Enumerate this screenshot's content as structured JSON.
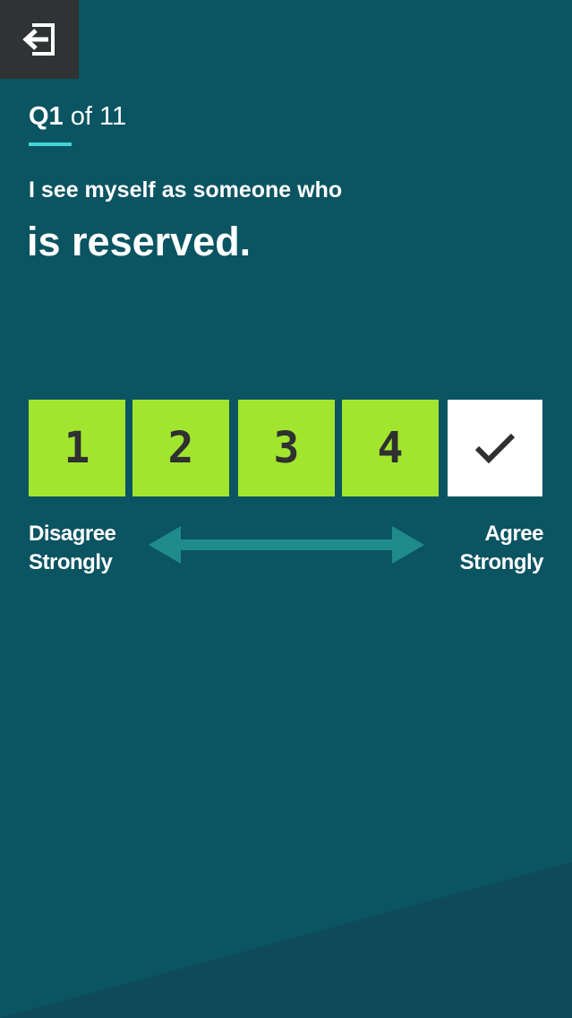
{
  "header": {
    "exit_icon": "exit-arrow-icon"
  },
  "progress": {
    "current": "Q1",
    "of_text": "of 11",
    "underline_color": "#3fd6d4"
  },
  "question": {
    "lead": "I see myself as someone who",
    "statement": "is reserved."
  },
  "scale": {
    "options": [
      "1",
      "2",
      "3",
      "4"
    ],
    "selected_icon": "checkmark-icon",
    "left_label": [
      "Disagree",
      "Strongly"
    ],
    "right_label": [
      "Agree",
      "Strongly"
    ],
    "arrow_icon": "double-arrow-icon"
  },
  "colors": {
    "background": "#0b5462",
    "option": "#a1e52e",
    "selected_option": "#ffffff",
    "arrow": "#1f8b8a",
    "exit_button": "#2f3333"
  }
}
